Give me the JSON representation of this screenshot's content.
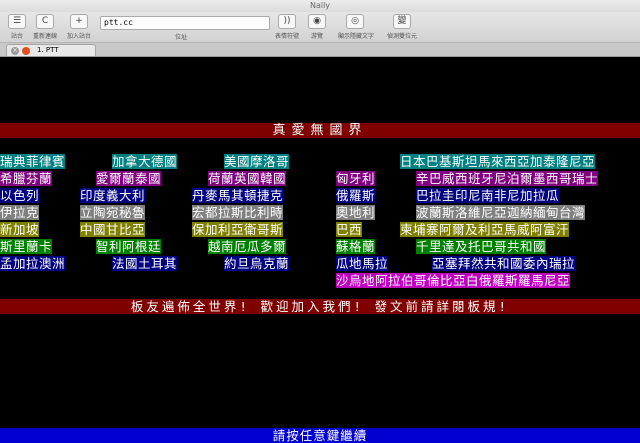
{
  "window": {
    "title": "Nally"
  },
  "toolbar": {
    "connect_label": "站台",
    "reconnect_label": "重新連線",
    "add_label": "加入站台",
    "address_value": "ptt.cc",
    "address_label": "位址",
    "emoticon_label": "表情符號",
    "browse_label": "游覽",
    "show_hidden_label": "顯示隱藏文字",
    "encoding_label": "偵測雙位元",
    "reconnect_icon": "C",
    "add_icon": "+",
    "emoticon_icon": "))",
    "browse_icon": "◉",
    "show_hidden_icon": "◎",
    "encoding_icon": "變"
  },
  "tab": {
    "label": "1. PTT",
    "close_icon": "×"
  },
  "terminal": {
    "top_banner": "真愛無國界",
    "middle_banner": "板友遍佈全世界! 歡迎加入我們! 發文前請詳閱板規!",
    "footer": "請按任意鍵繼續",
    "rows": [
      [
        "瑞典菲律賓",
        "加拿大德國",
        "美國摩洛哥",
        "日本巴基斯坦馬來西亞加泰隆尼亞"
      ],
      [
        "希臘芬蘭",
        "愛爾蘭泰國",
        "荷蘭英國韓國",
        "匈牙利",
        "辛巴威西班牙尼泊爾墨西哥瑞士"
      ],
      [
        "以色列",
        "印度義大利",
        "丹麥馬其頓捷克",
        "俄羅斯",
        "巴拉圭印尼南非尼加拉瓜"
      ],
      [
        "伊拉克",
        "立陶宛秘魯",
        "宏都拉斯比利時",
        "奧地利",
        "波蘭斯洛維尼亞迦納緬甸台灣"
      ],
      [
        "新加坡",
        "中國甘比亞",
        "保加利亞衛哥斯",
        "巴西",
        "柬埔寨阿爾及利亞馬威阿富汗"
      ],
      [
        "斯里蘭卡",
        "智利阿根廷",
        "越南厄瓜多爾",
        "蘇格蘭",
        "千里達及托巴哥共和國"
      ],
      [
        "孟加拉澳洲",
        "法國土耳其",
        "約旦烏克蘭",
        "瓜地馬拉",
        "亞塞拜然共和國委內瑞拉"
      ],
      [
        "沙烏地阿拉伯哥倫比亞白俄羅斯羅馬尼亞"
      ]
    ]
  },
  "colors": {
    "banner_bg": "#800000",
    "footer_bg": "#0000d0",
    "ansi_cyan": "#008080",
    "ansi_magenta": "#800080",
    "ansi_blue": "#000080",
    "ansi_gray": "#808080",
    "ansi_green": "#008000",
    "ansi_olive": "#808000"
  }
}
